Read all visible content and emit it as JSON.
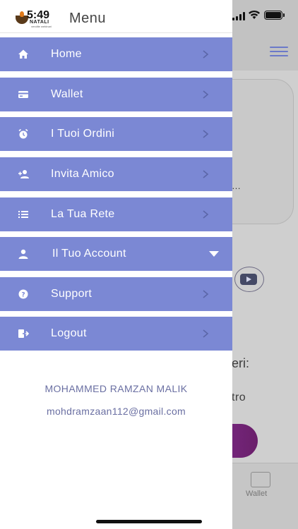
{
  "status_bar": {
    "time": "5:49"
  },
  "app": {
    "logo_brand": "NATALI",
    "logo_tagline": "vendite webinari"
  },
  "drawer": {
    "title": "Menu",
    "items": [
      {
        "label": "Home",
        "icon": "home-icon"
      },
      {
        "label": "Wallet",
        "icon": "credit-card-icon"
      },
      {
        "label": "I Tuoi Ordini",
        "icon": "alarm-clock-icon"
      },
      {
        "label": "Invita Amico",
        "icon": "person-add-icon"
      },
      {
        "label": "La Tua Rete",
        "icon": "list-icon"
      },
      {
        "label": "Il Tuo Account",
        "icon": "person-icon",
        "expanded": true
      },
      {
        "label": "Support",
        "icon": "help-icon"
      },
      {
        "label": "Logout",
        "icon": "logout-icon"
      }
    ],
    "user": {
      "name": "MOHAMMED RAMZAN MALIK",
      "email": "mohdramzaan112@gmail.com"
    }
  },
  "background": {
    "card_text": "…",
    "text1": "eri:",
    "text2": "tro",
    "tab_wallet_label": "Wallet"
  },
  "colors": {
    "menu_item_bg": "#7b88d4",
    "accent": "#6b79c9",
    "user_text": "#6a6fa2"
  }
}
